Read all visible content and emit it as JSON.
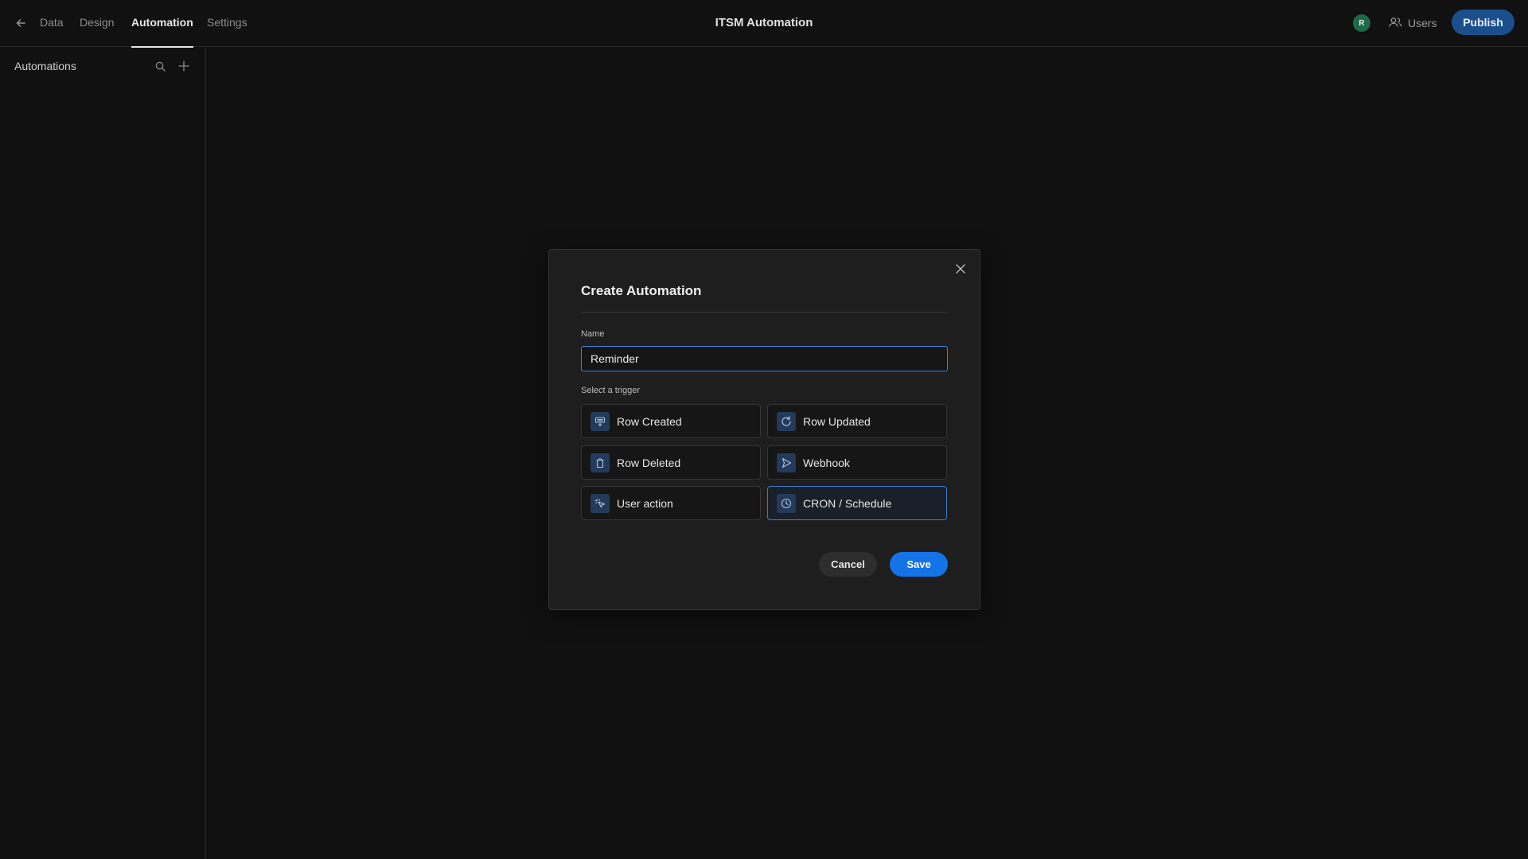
{
  "header": {
    "tabs": [
      {
        "label": "Data",
        "active": false
      },
      {
        "label": "Design",
        "active": false
      },
      {
        "label": "Automation",
        "active": true
      },
      {
        "label": "Settings",
        "active": false
      }
    ],
    "app_title": "ITSM Automation",
    "avatar_initial": "R",
    "users_label": "Users",
    "publish_label": "Publish"
  },
  "sidebar": {
    "title": "Automations",
    "icons": [
      "search-icon",
      "plus-icon"
    ]
  },
  "modal": {
    "title": "Create Automation",
    "name_label": "Name",
    "name_value": "Reminder",
    "trigger_label": "Select a trigger",
    "triggers": [
      {
        "label": "Row Created",
        "icon": "row-created-icon",
        "selected": false
      },
      {
        "label": "Row Updated",
        "icon": "refresh-icon",
        "selected": false
      },
      {
        "label": "Row Deleted",
        "icon": "trash-icon",
        "selected": false
      },
      {
        "label": "Webhook",
        "icon": "send-icon",
        "selected": false
      },
      {
        "label": "User action",
        "icon": "cursor-click-icon",
        "selected": false
      },
      {
        "label": "CRON / Schedule",
        "icon": "clock-icon",
        "selected": true
      }
    ],
    "cancel_label": "Cancel",
    "save_label": "Save"
  },
  "colors": {
    "background": "#111111",
    "modal_bg": "#1e1e1e",
    "accent": "#1473e6",
    "publish": "#1a4f8c",
    "avatar": "#1c6a4a",
    "icon_tile": "#243a5a"
  }
}
